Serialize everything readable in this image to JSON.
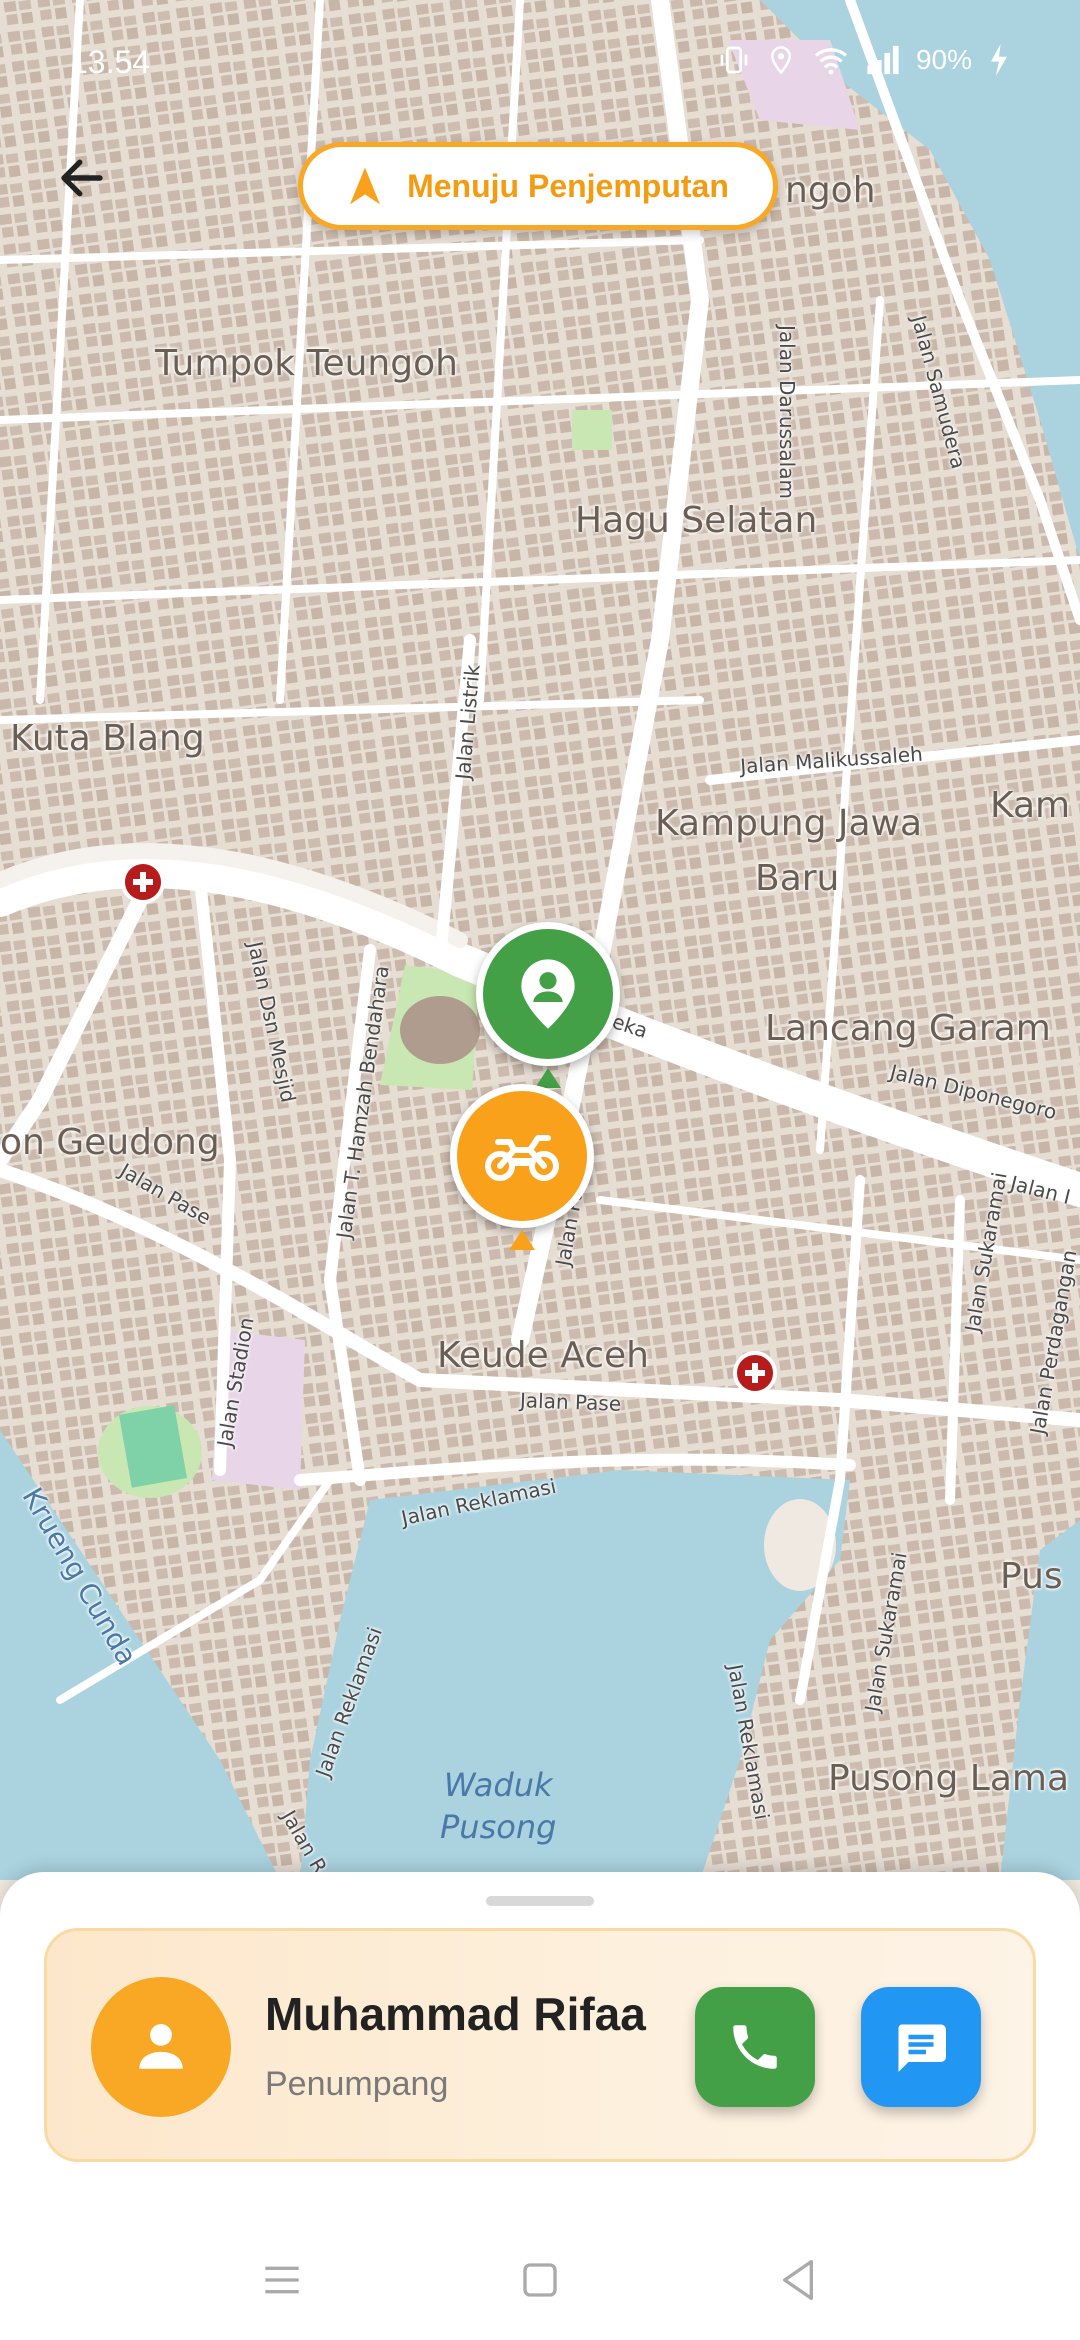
{
  "status_bar": {
    "time": "13.54",
    "battery": "90%",
    "icons": [
      "vibrate-icon",
      "location-icon",
      "wifi-icon",
      "signal-icon",
      "battery-charging-icon"
    ]
  },
  "header": {
    "back_icon": "arrow-left-icon",
    "status_pill": {
      "label": "Menuju Penjemputan",
      "icon": "navigation-arrow-icon"
    }
  },
  "map": {
    "area_labels": [
      "ngoh",
      "Tumpok Teungoh",
      "Hagu Selatan",
      "Kuta Blang",
      "Kampung Jawa",
      "Baru",
      "Kam",
      "Lancang Garam",
      "on Geudong",
      "Keude Aceh",
      "Pus",
      "Pusong Lama"
    ],
    "street_labels": [
      "Jalan Darussalam",
      "Jalan Samudera",
      "Jalan Listrik",
      "Jalan Malikussaleh",
      "Jalan Dsn Mesjid",
      "Jalan T. Hamzah Bendahara",
      "eka",
      "Jalan Diponegoro",
      "Jalan Pase",
      "Jalan Pa",
      "Jalan Sukaramai",
      "Jalan Perdagangan",
      "Jalan Stadion",
      "Jalan Pase",
      "Jalan Reklamasi",
      "Jalan Reklamasi",
      "Jalan Sukaramai",
      "Jalan Reklamasi",
      "Krueng Cunda",
      "Jalan R",
      "Jalan I"
    ],
    "water_label": [
      "Waduk",
      "Pusong"
    ],
    "pickup_marker_icon": "location-person-pin-icon",
    "driver_marker_icon": "motorcycle-icon"
  },
  "passenger": {
    "name": "Muhammad Rifaa",
    "role": "Penumpang",
    "avatar_icon": "person-icon",
    "call_icon": "phone-icon",
    "chat_icon": "chat-icon"
  },
  "colors": {
    "accent_orange": "#f9a825",
    "green": "#43a047",
    "blue": "#2196f3"
  },
  "nav_bar": {
    "icons": [
      "menu-icon",
      "home-square-icon",
      "back-triangle-icon"
    ]
  }
}
